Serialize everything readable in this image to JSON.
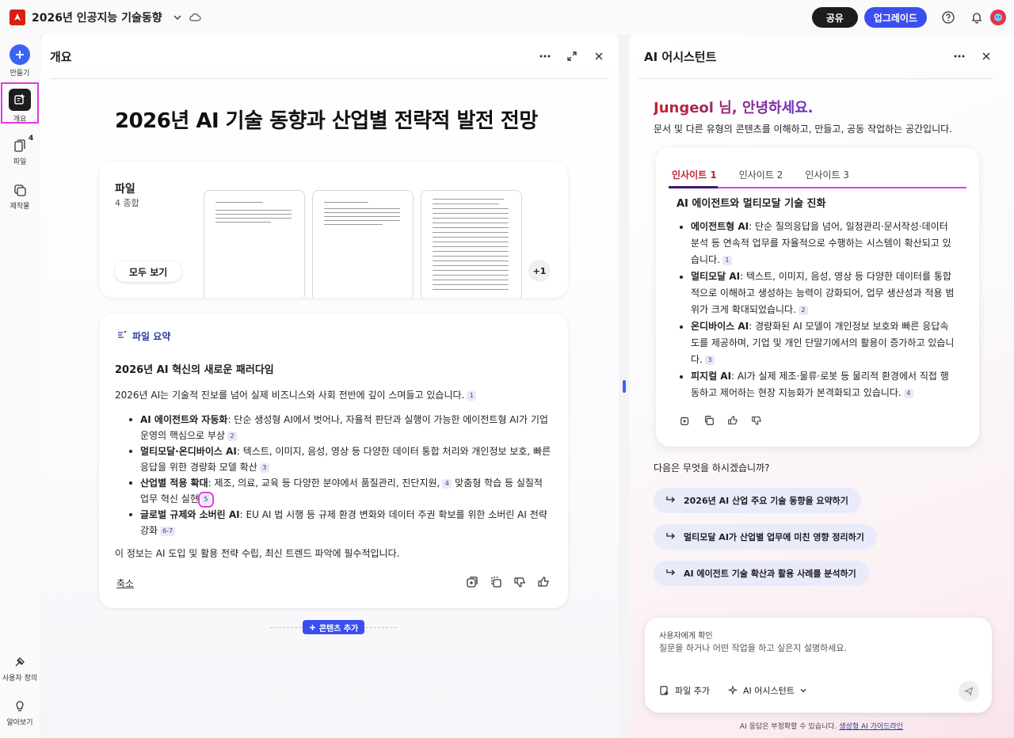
{
  "topbar": {
    "doc_title": "2026년 인공지능 기술동향",
    "share_label": "공유",
    "upgrade_label": "업그레이드"
  },
  "rail": {
    "create_label": "만들기",
    "overview_label": "개요",
    "files_label": "파일",
    "files_count": "4",
    "creations_label": "제작물",
    "customize_label": "사용자 정의",
    "learn_label": "알아보기"
  },
  "overview_panel": {
    "title": "개요",
    "heading": "2026년 AI 기술 동향과 산업별 전략적 발전 전망",
    "files_card": {
      "title": "파일",
      "count": "4 종합",
      "view_all": "모두 보기",
      "more": "+1"
    },
    "summary": {
      "label": "파일 요약",
      "heading": "2026년 AI 혁신의 새로운 패러다임",
      "intro": "2026년 AI는 기술적 진보를 넘어 실제 비즈니스와 사회 전반에 깊이 스며들고 있습니다.",
      "intro_cite": "1",
      "items": [
        {
          "bold": "AI 에이전트와 자동화",
          "text": ": 단순 생성형 AI에서 벗어나, 자율적 판단과 실행이 가능한 에이전트형 AI가 기업 운영의 핵심으로 부상",
          "cite": "2"
        },
        {
          "bold": "멀티모달·온디바이스 AI",
          "text": ": 텍스트, 이미지, 음성, 영상 등 다양한 데이터 통합 처리와 개인정보 보호, 빠른 응답을 위한 경량화 모델 확산",
          "cite": "3"
        },
        {
          "bold": "산업별 적용 확대",
          "text": ": 제조, 의료, 교육 등 다양한 분야에서 품질관리, 진단지원,",
          "cite_mid": "4",
          "text2": " 맞춤형 학습 등 실질적 업무 혁신 실현",
          "cite": "5"
        },
        {
          "bold": "글로벌 규제와 소버린 AI",
          "text": ": EU AI 법 시행 등 규제 환경 변화와 데이터 주권 확보를 위한 소버린 AI 전략 강화",
          "cite": "6-7"
        }
      ],
      "outro": "이 정보는 AI 도입 및 활용 전략 수립, 최신 트렌드 파악에 필수적입니다.",
      "collapse": "축소"
    },
    "add_content": "콘텐츠 추가"
  },
  "assistant_panel": {
    "title": "AI 어시스턴트",
    "greeting": "Jungeol 님, 안녕하세요.",
    "subtitle": "문서 및 다른 유형의 콘텐츠를 이해하고, 만들고, 공동 작업하는 공간입니다.",
    "tabs": [
      "인사이트 1",
      "인사이트 2",
      "인사이트 3"
    ],
    "insight": {
      "heading": "AI 에이전트와 멀티모달 기술 진화",
      "items": [
        {
          "bold": "에이전트형 AI",
          "text": ": 단순 질의응답을 넘어, 일정관리·문서작성·데이터 분석 등 연속적 업무를 자율적으로 수행하는 시스템이 확산되고 있습니다.",
          "cite": "1"
        },
        {
          "bold": "멀티모달 AI",
          "text": ": 텍스트, 이미지, 음성, 영상 등 다양한 데이터를 통합적으로 이해하고 생성하는 능력이 강화되어, 업무 생산성과 적용 범위가 크게 확대되었습니다.",
          "cite": "2"
        },
        {
          "bold": "온디바이스 AI",
          "text": ": 경량화된 AI 모델이 개인정보 보호와 빠른 응답속도를 제공하며, 기업 및 개인 단말기에서의 활용이 증가하고 있습니다.",
          "cite": "3"
        },
        {
          "bold": "피지컬 AI",
          "text": ": AI가 실제 제조·물류·로봇 등 물리적 환경에서 직접 행동하고 제어하는 현장 지능화가 본격화되고 있습니다.",
          "cite": "4"
        }
      ]
    },
    "next_question": "다음은 무엇을 하시겠습니까?",
    "suggestions": [
      "2026년 AI 산업 주요 기술 동향을 요약하기",
      "멀티모달 AI가 산업별 업무에 미친 영향 정리하기",
      "AI 에이전트 기술 확산과 활용 사례를 분석하기"
    ],
    "composer": {
      "label": "사용자에게 확인",
      "placeholder": "질문을 하거나 어떤 작업을 하고 싶은지 설명하세요.",
      "add_file": "파일 추가",
      "assistant_mode": "AI 어시스턴트"
    },
    "disclaimer": "AI 응답은 부정확할 수 있습니다.",
    "disclaimer_link": "생성형 AI 가이드라인"
  },
  "colors": {
    "accent": "#3b4ef0",
    "brand_red": "#d7200f",
    "highlight": "#e03ce0"
  }
}
